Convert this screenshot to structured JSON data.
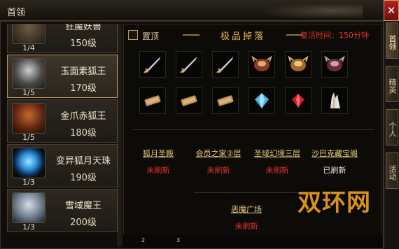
{
  "window": {
    "title": "首领"
  },
  "close": {
    "label": "✕"
  },
  "side_tabs": [
    "首领",
    "精英",
    "个人",
    "活动"
  ],
  "bosses": [
    {
      "name": "狂魔妖兽",
      "count": "1/4",
      "level": "150级",
      "selected": false
    },
    {
      "name": "玉面素狐王",
      "count": "1/5",
      "level": "170级",
      "selected": true
    },
    {
      "name": "金爪赤狐王",
      "count": "1/5",
      "level": "180级",
      "selected": false
    },
    {
      "name": "变异狐月天珠",
      "count": "1/3",
      "level": "190级",
      "selected": false
    },
    {
      "name": "雪域魔王",
      "count": "1/3",
      "level": "200级",
      "selected": false
    }
  ],
  "panel": {
    "pin_label": "置顶",
    "drop_title": "极品掉落",
    "respawn": "复活时间：150分钟"
  },
  "drops": [
    {
      "icon": "sword-icon"
    },
    {
      "icon": "sword-icon"
    },
    {
      "icon": "sword-icon"
    },
    {
      "icon": "helmet-icon"
    },
    {
      "icon": "helmet-icon"
    },
    {
      "icon": "helmet-icon"
    },
    {
      "icon": "scroll-icon"
    },
    {
      "icon": "scroll-icon"
    },
    {
      "icon": "scroll-icon"
    },
    {
      "icon": "blue-gem-icon"
    },
    {
      "icon": "red-gem-icon"
    },
    {
      "icon": "crystal-icon"
    }
  ],
  "locations": [
    {
      "name": "狐月圣殿",
      "status": "未刷新"
    },
    {
      "name": "会员之家②层",
      "status": "未刷新"
    },
    {
      "name": "圣域幻境三层",
      "status": "未刷新"
    },
    {
      "name": "沙巴克藏宝阁",
      "status": "已刷新"
    },
    {
      "name": "恶魔广场",
      "status": "未刷新"
    }
  ],
  "watermark": "双环网",
  "bottom_numbers": [
    "2",
    "3"
  ],
  "colors": {
    "accent": "#e8cf79",
    "status_red": "#e0312a",
    "status_white": "#eae3d3"
  }
}
